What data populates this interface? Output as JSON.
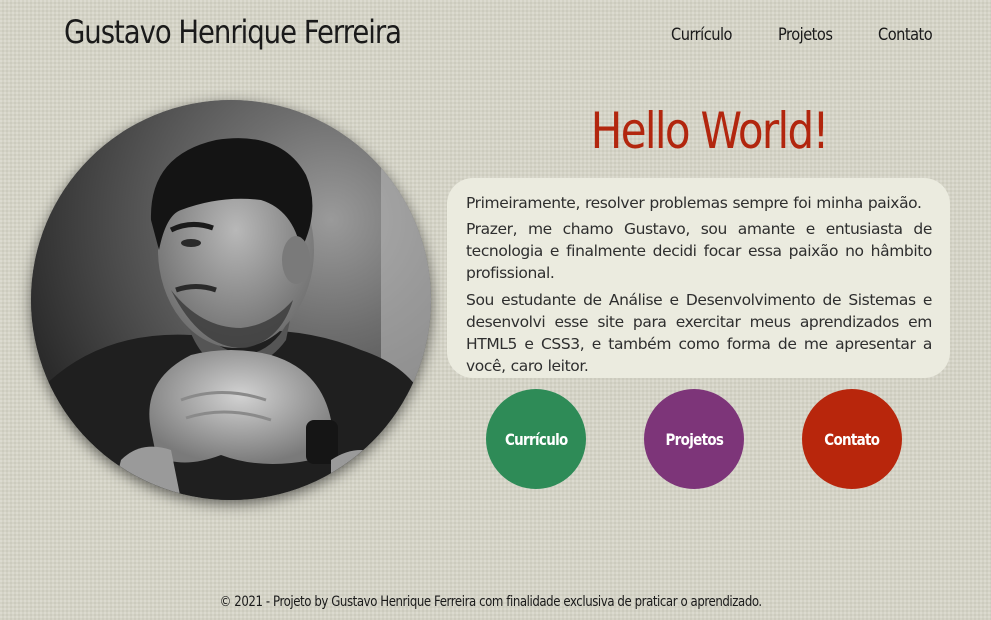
{
  "header": {
    "site_title": "Gustavo Henrique Ferreira",
    "nav": [
      {
        "label": "Currículo"
      },
      {
        "label": "Projetos"
      },
      {
        "label": "Contato"
      }
    ]
  },
  "portrait": {
    "icon": "profile-photo"
  },
  "main": {
    "heading": "Hello World!",
    "paragraphs": [
      "Primeiramente, resolver problemas sempre foi minha paixão.",
      "Prazer, me chamo Gustavo, sou amante e entusiasta de tecnologia e finalmente decidi focar essa paixão no hâmbito profissional.",
      "Sou estudante de Análise e Desenvolvimento de Sistemas e desenvolvi esse site para exercitar meus aprendizados em HTML5 e CSS3, e também como forma de me apresentar a você, caro leitor."
    ],
    "buttons": [
      {
        "label": "Currículo",
        "color": "#2e8b57"
      },
      {
        "label": "Projetos",
        "color": "#7d3579"
      },
      {
        "label": "Contato",
        "color": "#b8260c"
      }
    ]
  },
  "footer": {
    "text": "© 2021 - Projeto by Gustavo Henrique Ferreira com finalidade exclusiva de praticar o aprendizado."
  },
  "colors": {
    "background": "#d4d3c6",
    "heading": "#b2260e",
    "card": "#ebebdf"
  }
}
